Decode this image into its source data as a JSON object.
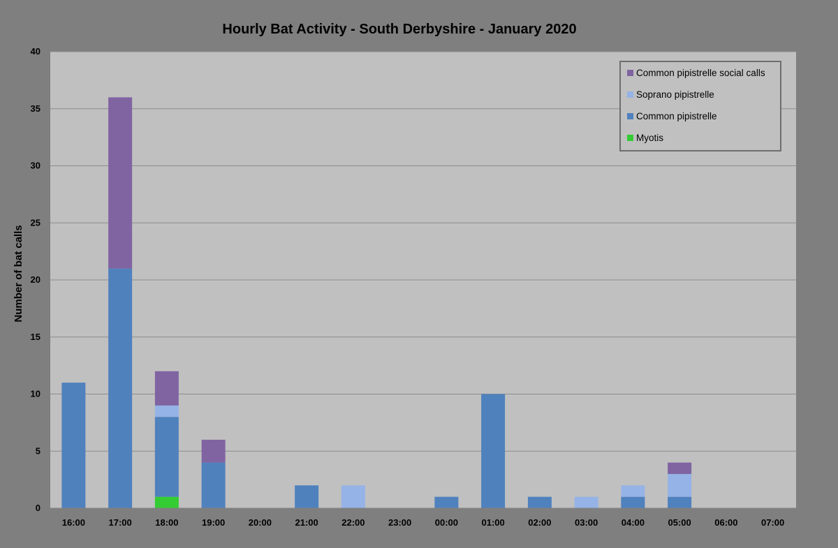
{
  "chart_data": {
    "type": "bar",
    "stacked": true,
    "title": "Hourly Bat Activity - South Derbyshire - January 2020",
    "xlabel": "",
    "ylabel": "Number of bat calls",
    "ylim": [
      0,
      40
    ],
    "yticks": [
      0,
      5,
      10,
      15,
      20,
      25,
      30,
      35,
      40
    ],
    "grid": true,
    "legend_position": "top-right",
    "categories": [
      "16:00",
      "17:00",
      "18:00",
      "19:00",
      "20:00",
      "21:00",
      "22:00",
      "23:00",
      "00:00",
      "01:00",
      "02:00",
      "03:00",
      "04:00",
      "05:00",
      "06:00",
      "07:00"
    ],
    "series": [
      {
        "name": "Myotis",
        "color": "#33cc33",
        "values": [
          0,
          0,
          1,
          0,
          0,
          0,
          0,
          0,
          0,
          0,
          0,
          0,
          0,
          0,
          0,
          0
        ]
      },
      {
        "name": "Common pipistrelle",
        "color": "#4f81bd",
        "values": [
          11,
          21,
          7,
          4,
          0,
          2,
          0,
          0,
          1,
          10,
          1,
          0,
          1,
          1,
          0,
          0
        ]
      },
      {
        "name": "Soprano pipistrelle",
        "color": "#95b3e6",
        "values": [
          0,
          0,
          1,
          0,
          0,
          0,
          2,
          0,
          0,
          0,
          0,
          1,
          1,
          2,
          0,
          0
        ]
      },
      {
        "name": "Common pipistrelle social calls",
        "color": "#8064a2",
        "values": [
          0,
          15,
          3,
          2,
          0,
          0,
          0,
          0,
          0,
          0,
          0,
          0,
          0,
          1,
          0,
          0
        ]
      }
    ]
  },
  "colors": {
    "background": "#7f7f7f",
    "plot_area": "#c0c0c0",
    "gridline": "#8c8c8c"
  }
}
